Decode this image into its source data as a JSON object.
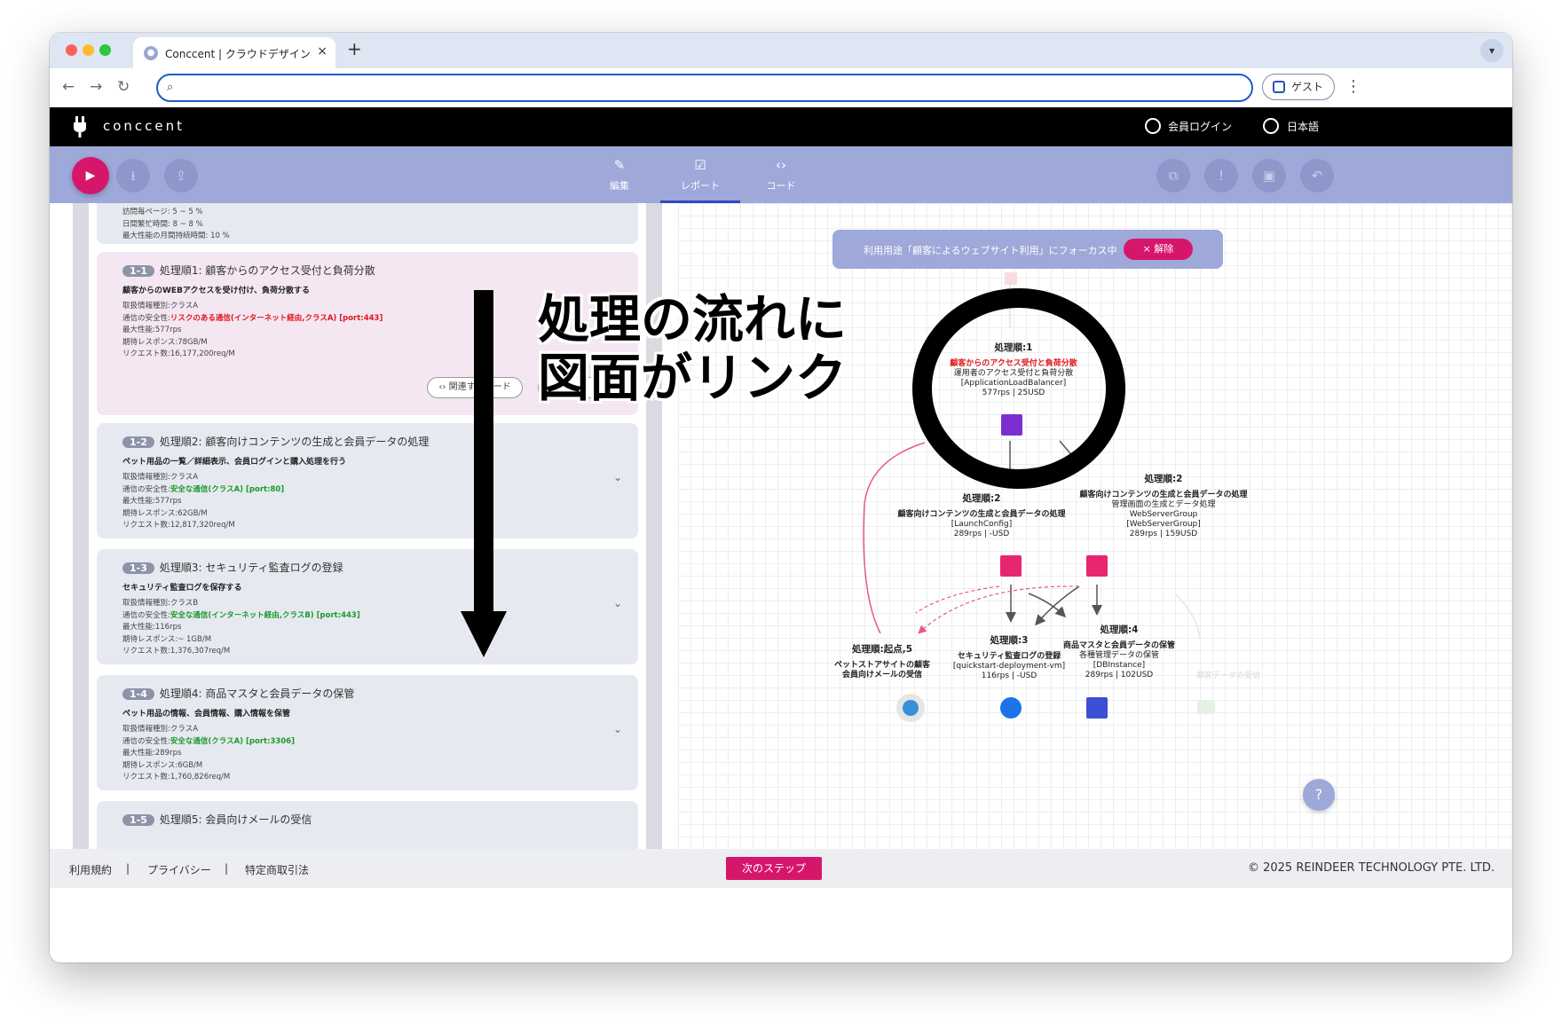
{
  "browser": {
    "tab_title": "Conccent | クラウドデザインベ",
    "tab_close": "×",
    "new_tab": "+",
    "url": "",
    "guest_label": "ゲスト"
  },
  "app": {
    "logo": "conccent",
    "login": "会員ログイン",
    "language": "日本語"
  },
  "mode_tabs": [
    {
      "label": "編集",
      "icon": "pencil-icon"
    },
    {
      "label": "レポート",
      "icon": "checklist-icon",
      "active": true
    },
    {
      "label": "コード",
      "icon": "code-icon"
    }
  ],
  "left": {
    "top_lines": [
      "訪問毎ページ: 5 ~ 5 %",
      "日間繁忙時間: 8 ~ 8 %",
      "最大性能の月間持続時間: 10 %"
    ],
    "cards": [
      {
        "badge": "1-1",
        "title": "処理順1: 顧客からのアクセス受付と負荷分散",
        "desc": "顧客からのWEBアクセスを受け付け、負荷分散する",
        "line1": "取扱情報種別:クラスA",
        "safety_label": "通信の安全性:",
        "safety_value": "リスクのある通信(インターネット経由,クラスA) [port:443]",
        "line3": "最大性能:577rps",
        "line4": "期待レスポンス:78GB/M",
        "line5": "リクエスト数:16,177,200req/M",
        "related": "関連するコード"
      },
      {
        "badge": "1-2",
        "title": "処理順2: 顧客向けコンテンツの生成と会員データの処理",
        "desc": "ペット用品の一覧／詳細表示、会員ログインと購入処理を行う",
        "line1": "取扱情報種別:クラスA",
        "safety_label": "通信の安全性:",
        "safety_value": "安全な通信(クラスA) [port:80]",
        "line3": "最大性能:577rps",
        "line4": "期待レスポンス:62GB/M",
        "line5": "リクエスト数:12,817,320req/M"
      },
      {
        "badge": "1-3",
        "title": "処理順3: セキュリティ監査ログの登録",
        "desc": "セキュリティ監査ログを保存する",
        "line1": "取扱情報種別:クラスB",
        "safety_label": "通信の安全性:",
        "safety_value": "安全な通信(インターネット経由,クラスB) [port:443]",
        "line3": "最大性能:116rps",
        "line4": "期待レスポンス:~ 1GB/M",
        "line5": "リクエスト数:1,376,307req/M"
      },
      {
        "badge": "1-4",
        "title": "処理順4: 商品マスタと会員データの保管",
        "desc": "ペット用品の情報、会員情報、購入情報を保管",
        "line1": "取扱情報種別:クラスA",
        "safety_label": "通信の安全性:",
        "safety_value": "安全な通信(クラスA) [port:3306]",
        "line3": "最大性能:289rps",
        "line4": "期待レスポンス:6GB/M",
        "line5": "リクエスト数:1,760,826req/M"
      },
      {
        "badge": "1-5",
        "title": "処理順5: 会員向けメールの受信"
      }
    ]
  },
  "annotation": {
    "line1": "処理の流れに",
    "line2": "図面がリンク"
  },
  "diagram": {
    "focus_text": "利用用途「顧客によるウェブサイト利用」にフォーカス中",
    "focus_clear": "× 解除",
    "node1": {
      "title": "処理順:1",
      "sub": "顧客からのアクセス受付と負荷分散",
      "l1": "運用者のアクセス受付と負荷分散",
      "l2": "[ApplicationLoadBalancer]",
      "l3": "577rps | 25USD"
    },
    "node2a": {
      "title": "処理順:2",
      "sub": "顧客向けコンテンツの生成と会員データの処理",
      "l1": "[LaunchConfig]",
      "l2": "289rps | -USD"
    },
    "node2b": {
      "title": "処理順:2",
      "sub": "顧客向けコンテンツの生成と会員データの処理",
      "l1": "管理画面の生成とデータ処理",
      "l2": "WebServerGroup",
      "l3": "[WebServerGroup]",
      "l4": "289rps | 159USD"
    },
    "node5": {
      "title": "処理順:起点,5",
      "sub": "ペットストアサイトの顧客",
      "l1": "会員向けメールの受信"
    },
    "node3": {
      "title": "処理順:3",
      "sub": "セキュリティ監査ログの登録",
      "l1": "[quickstart-deployment-vm]",
      "l2": "116rps | -USD"
    },
    "node4": {
      "title": "処理順:4",
      "sub": "商品マスタと会員データの保管",
      "l1": "各種管理データの保管",
      "l2": "[DBInstance]",
      "l3": "289rps | 102USD"
    },
    "faded_label": "顧客データの受信",
    "help": "?"
  },
  "footer": {
    "terms": "利用規約",
    "sep": "|",
    "privacy": "プライバシー",
    "commerce": "特定商取引法",
    "next": "次のステップ",
    "copyright": "© 2025 REINDEER TECHNOLOGY PTE. LTD."
  },
  "colors": {
    "accent": "#d6166b",
    "toolbar": "#9ea8d9",
    "risk": "#e0161f",
    "safe": "#1b9a2a"
  }
}
